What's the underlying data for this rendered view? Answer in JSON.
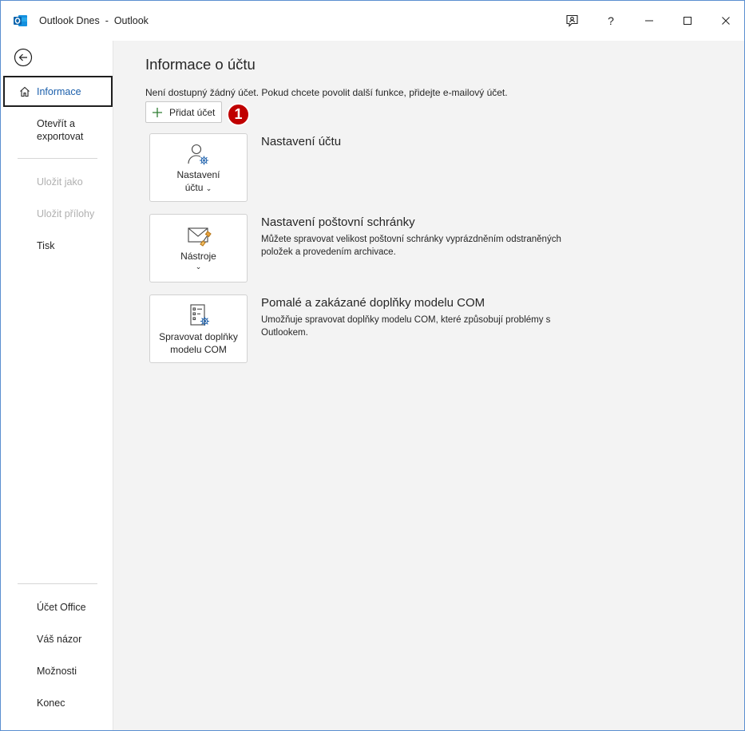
{
  "window": {
    "app_name": "Outlook Dnes",
    "separator": "-",
    "product": "Outlook"
  },
  "sidebar": {
    "items": [
      {
        "label": "Informace"
      },
      {
        "label_line1": "Otevřít a",
        "label_line2": "exportovat"
      },
      {
        "label": "Uložit jako"
      },
      {
        "label": "Uložit přílohy"
      },
      {
        "label": "Tisk"
      },
      {
        "label": "Účet Office"
      },
      {
        "label": "Váš názor"
      },
      {
        "label": "Možnosti"
      },
      {
        "label": "Konec"
      }
    ]
  },
  "main": {
    "title": "Informace o účtu",
    "subtitle": "Není dostupný žádný účet. Pokud chcete povolit další funkce, přidejte e-mailový účet.",
    "add_account_label": "Přidat účet",
    "badge": "1",
    "sections": [
      {
        "card_line1": "Nastavení",
        "card_line2": "účtu",
        "title": "Nastavení účtu",
        "description": ""
      },
      {
        "card_line1": "Nástroje",
        "title": "Nastavení poštovní schránky",
        "description": "Můžete spravovat velikost poštovní schránky vyprázdněním odstraněných položek a provedením archivace."
      },
      {
        "card_line1": "Spravovat doplňky",
        "card_line2": "modelu COM",
        "title": "Pomalé a zakázané doplňky modelu COM",
        "description": "Umožňuje spravovat doplňky modelu COM, které způsobují problémy s Outlookem."
      }
    ]
  },
  "colors": {
    "accent": "#1b5fab",
    "badge": "#c00000",
    "plus": "#2e7d32"
  }
}
